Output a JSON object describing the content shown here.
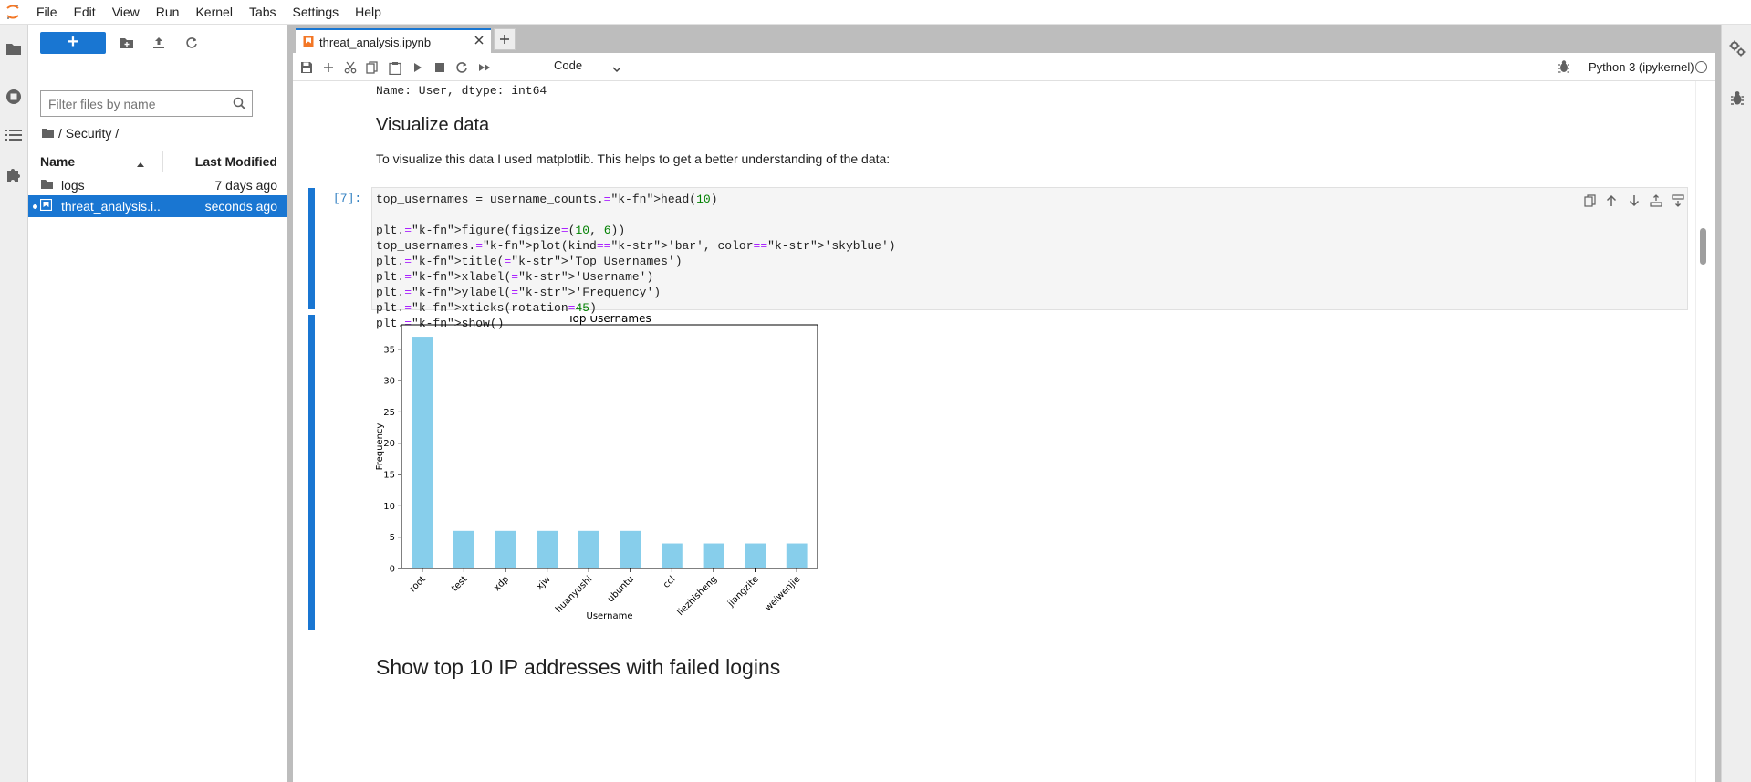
{
  "menu": [
    "File",
    "Edit",
    "View",
    "Run",
    "Kernel",
    "Tabs",
    "Settings",
    "Help"
  ],
  "filebrowser": {
    "new_label": "+",
    "filter_placeholder": "Filter files by name",
    "breadcrumb": "/ Security /",
    "columns": {
      "name": "Name",
      "modified": "Last Modified"
    },
    "rows": [
      {
        "name": "logs",
        "modified": "7 days ago",
        "type": "folder"
      },
      {
        "name": "threat_analysis.i...",
        "modified": "seconds ago",
        "type": "notebook"
      }
    ]
  },
  "tabs": [
    {
      "label": "threat_analysis.ipynb",
      "active": true
    }
  ],
  "toolbar": {
    "cell_type": "Code",
    "kernel_name": "Python 3 (ipykernel)"
  },
  "notebook": {
    "prev_output": "Name: User, dtype: int64",
    "heading1": "Visualize data",
    "text1": "To visualize this data I used matplotlib. This helps to get a better understanding of the data:",
    "prompt": "[7]:",
    "code": [
      "top_usernames = username_counts.head(10)",
      "",
      "plt.figure(figsize=(10, 6))",
      "top_usernames.plot(kind='bar', color='skyblue')",
      "plt.title('Top Usernames')",
      "plt.xlabel('Username')",
      "plt.ylabel('Frequency')",
      "plt.xticks(rotation=45)",
      "plt.show()"
    ],
    "heading2": "Show top 10 IP addresses with failed logins"
  },
  "colors": {
    "accent": "#1976d2",
    "bar": "#87ceeb"
  },
  "chart_data": {
    "type": "bar",
    "title": "Top Usernames",
    "xlabel": "Username",
    "ylabel": "Frequency",
    "categories": [
      "root",
      "test",
      "xdp",
      "xjw",
      "huanyushi",
      "ubuntu",
      "ccl",
      "liezhisheng",
      "jiangzite",
      "weiwenjie"
    ],
    "values": [
      37,
      6,
      6,
      6,
      6,
      6,
      4,
      4,
      4,
      4
    ],
    "ylim": [
      0,
      38.9
    ],
    "yticks": [
      0,
      5,
      10,
      15,
      20,
      25,
      30,
      35
    ],
    "grid": false,
    "tick_rotation": 45
  }
}
